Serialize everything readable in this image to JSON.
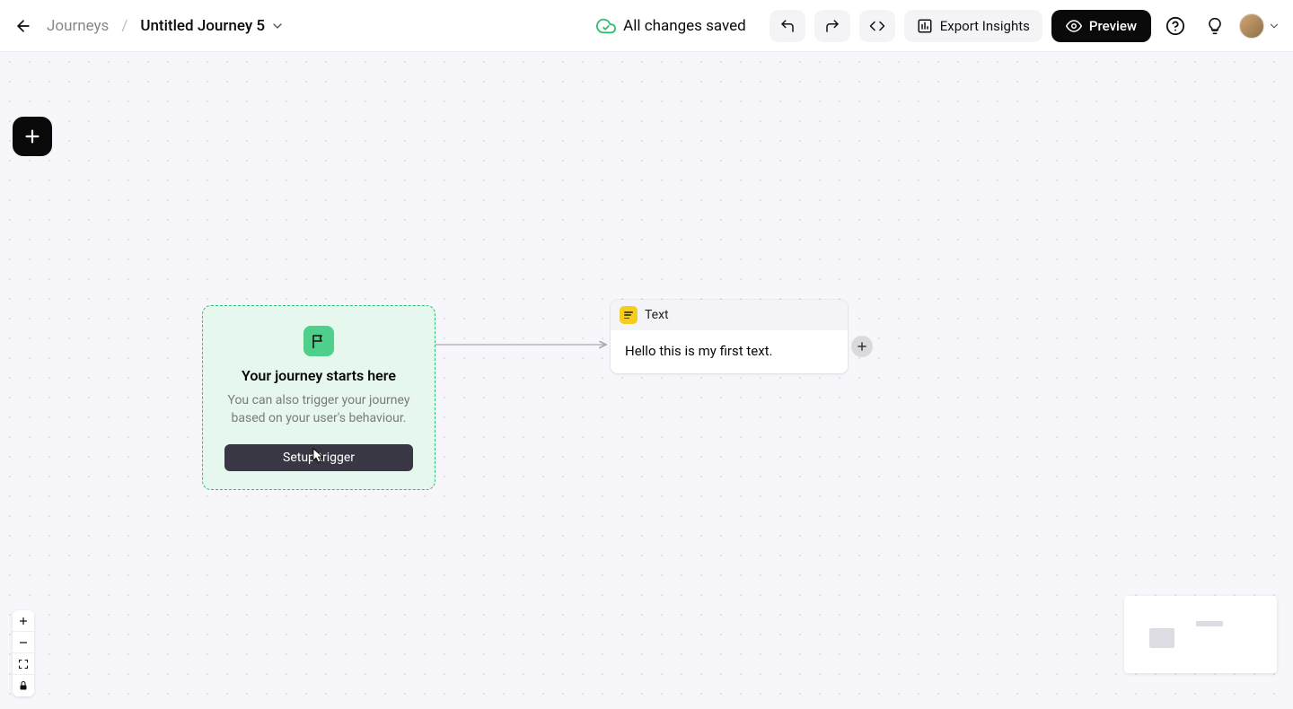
{
  "breadcrumb": {
    "root": "Journeys",
    "separator": "/",
    "current": "Untitled Journey 5"
  },
  "header": {
    "save_status": "All changes saved",
    "export_label": "Export Insights",
    "preview_label": "Preview"
  },
  "start_card": {
    "title": "Your journey starts here",
    "subtitle": "You can also trigger your journey based on your user's behaviour.",
    "button": "Setup trigger"
  },
  "text_node": {
    "badge_label": "Text",
    "content": "Hello this is my first text."
  },
  "icons": {
    "back": "back-arrow-icon",
    "chevron_down": "chevron-down-icon",
    "cloud": "cloud-check-icon",
    "undo": "undo-icon",
    "redo": "redo-icon",
    "code": "code-icon",
    "chart": "chart-icon",
    "eye": "eye-icon",
    "help": "help-icon",
    "lightbulb": "lightbulb-icon",
    "plus": "plus-icon",
    "flag": "flag-icon",
    "text_block": "text-block-icon",
    "zoom_in": "zoom-in-icon",
    "zoom_out": "zoom-out-icon",
    "fit": "fit-screen-icon",
    "lock": "lock-icon"
  },
  "colors": {
    "accent_green": "#2fbf71",
    "start_card_bg": "#e6f7ed",
    "flag_badge": "#4fd08a",
    "trigger_btn": "#3a3744",
    "text_badge": "#f5cd1f",
    "button_dark": "#0a0a0a",
    "canvas_bg": "#f7f6fb"
  }
}
